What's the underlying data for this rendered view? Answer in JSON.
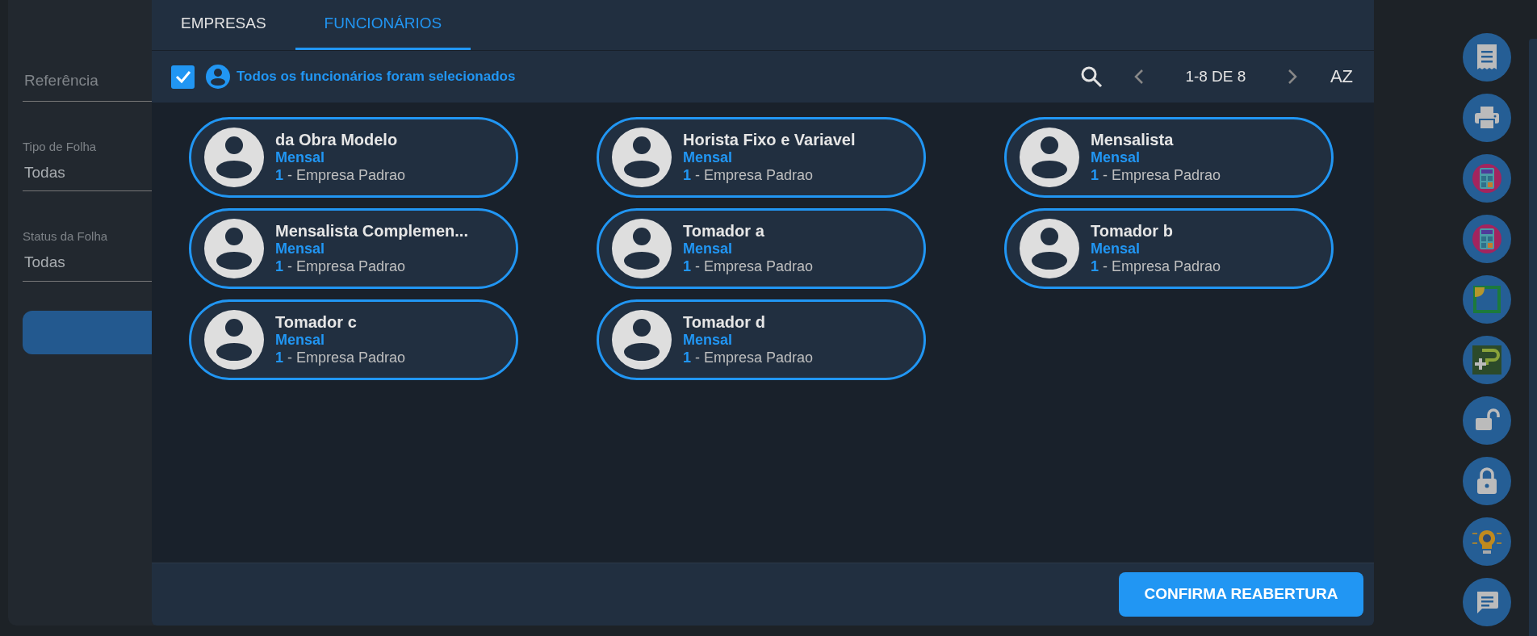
{
  "filters": {
    "reference": {
      "placeholder": "Referência"
    },
    "fields": [
      {
        "label": "Tipo de Folha",
        "value": "Todas"
      },
      {
        "label": "Status da Folha",
        "value": "Todas"
      }
    ]
  },
  "modal": {
    "tabs": [
      {
        "label": "EMPRESAS",
        "selected": false
      },
      {
        "label": "FUNCIONÁRIOS",
        "selected": true
      }
    ],
    "select_all": {
      "checked": true,
      "label": "Todos os funcionários foram selecionados"
    },
    "pagination": {
      "range": "1-8 DE 8"
    },
    "sort": {
      "label": "AZ"
    },
    "employees": [
      {
        "name": "da Obra Modelo",
        "payroll": "Mensal",
        "code": "1",
        "company": "- Empresa Padrao"
      },
      {
        "name": "Horista Fixo e Variavel",
        "payroll": "Mensal",
        "code": "1",
        "company": "- Empresa Padrao"
      },
      {
        "name": "Mensalista",
        "payroll": "Mensal",
        "code": "1",
        "company": "- Empresa Padrao"
      },
      {
        "name": "Mensalista Complemen...",
        "payroll": "Mensal",
        "code": "1",
        "company": "- Empresa Padrao"
      },
      {
        "name": "Tomador a",
        "payroll": "Mensal",
        "code": "1",
        "company": "- Empresa Padrao"
      },
      {
        "name": "Tomador b",
        "payroll": "Mensal",
        "code": "1",
        "company": "- Empresa Padrao"
      },
      {
        "name": "Tomador c",
        "payroll": "Mensal",
        "code": "1",
        "company": "- Empresa Padrao"
      },
      {
        "name": "Tomador d",
        "payroll": "Mensal",
        "code": "1",
        "company": "- Empresa Padrao"
      }
    ],
    "confirm_button": {
      "label": "CONFIRMA REABERTURA"
    }
  }
}
